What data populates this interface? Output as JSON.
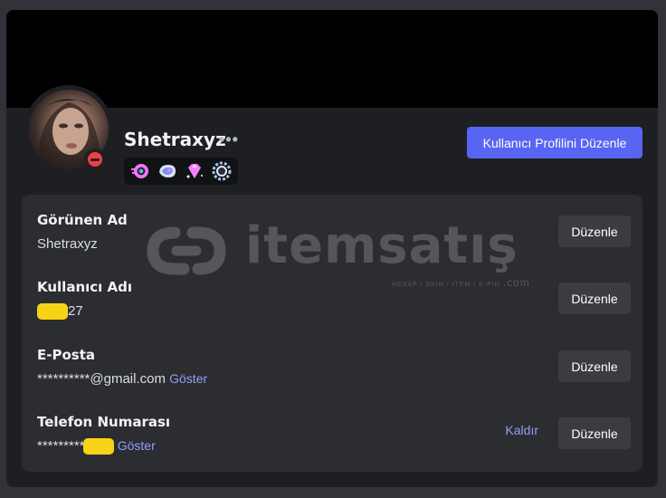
{
  "profile": {
    "username": "Shetraxyz",
    "more_glyph": "•••",
    "edit_profile_label": "Kullanıcı Profilini Düzenle",
    "status": "dnd",
    "badges": [
      "nitro-badge-icon",
      "boost-badge-icon",
      "gem-badge-icon",
      "quest-badge-icon"
    ]
  },
  "watermark": {
    "text": "itemsatış",
    "sub": "HESAP / SKIN / ITEM / E-PIN",
    "domain": ".com"
  },
  "account": {
    "display_name": {
      "label": "Görünen Ad",
      "value": "Shetraxyz",
      "edit_label": "Düzenle"
    },
    "username": {
      "label": "Kullanıcı Adı",
      "value_suffix": "27",
      "edit_label": "Düzenle"
    },
    "email": {
      "label": "E-Posta",
      "value": "**********@gmail.com",
      "show_label": "Göster",
      "edit_label": "Düzenle"
    },
    "phone": {
      "label": "Telefon Numarası",
      "value": "*********",
      "show_label": "Göster",
      "remove_label": "Kaldır",
      "edit_label": "Düzenle"
    }
  },
  "colors": {
    "accent": "#5865f2",
    "link": "#949cf7",
    "dnd": "#f23f43",
    "censor": "#f7d318"
  }
}
